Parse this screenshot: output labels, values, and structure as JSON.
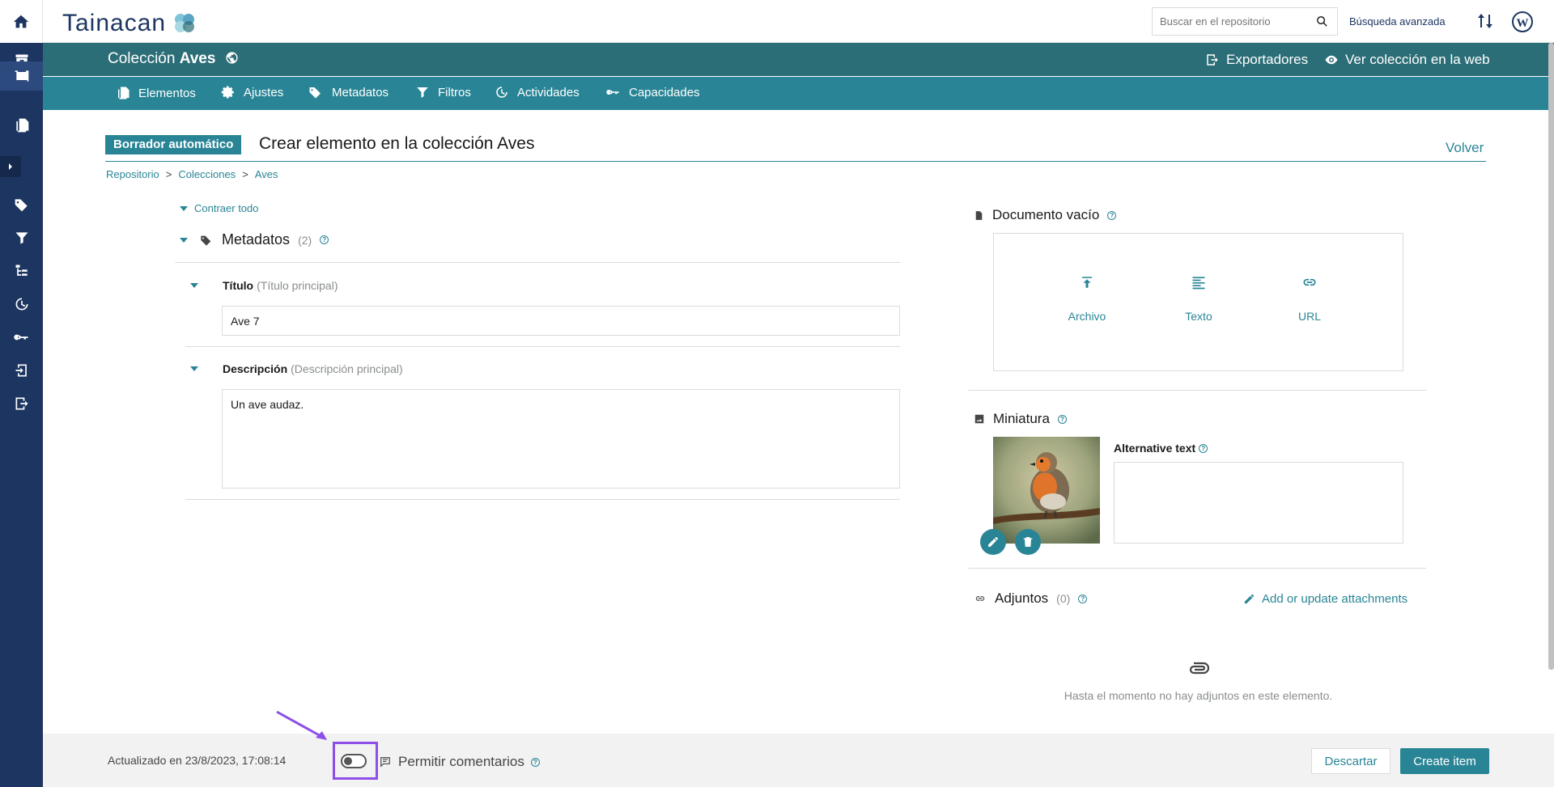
{
  "app": {
    "logo_text": "Tainacan",
    "accent": "#298596",
    "sidebar_bg": "#1d3661"
  },
  "topbar": {
    "search_placeholder": "Buscar en el repositorio",
    "advanced_search": "Búsqueda avanzada"
  },
  "collection": {
    "label": "Colección",
    "name": "Aves",
    "exporters": "Exportadores",
    "view_web": "Ver colección en la web"
  },
  "tabs": [
    {
      "label": "Elementos",
      "icon": "items-icon"
    },
    {
      "label": "Ajustes",
      "icon": "gear-icon"
    },
    {
      "label": "Metadatos",
      "icon": "tags-icon"
    },
    {
      "label": "Filtros",
      "icon": "filter-icon"
    },
    {
      "label": "Actividades",
      "icon": "activities-icon"
    },
    {
      "label": "Capacidades",
      "icon": "key-icon"
    }
  ],
  "page": {
    "badge": "Borrador automático",
    "title": "Crear elemento en la colección Aves",
    "back": "Volver",
    "breadcrumb": [
      "Repositorio",
      "Colecciones",
      "Aves"
    ],
    "breadcrumb_sep": ">"
  },
  "form": {
    "collapse_all": "Contraer todo",
    "metadata_section": "Metadatos",
    "metadata_count": "(2)",
    "fields": [
      {
        "label": "Título",
        "hint": "(Título principal)",
        "value": "Ave 7"
      },
      {
        "label": "Descripción",
        "hint": "(Descripción principal)",
        "value": "Un ave audaz."
      }
    ]
  },
  "document": {
    "title": "Documento vacío",
    "options": [
      "Archivo",
      "Texto",
      "URL"
    ]
  },
  "thumbnail": {
    "title": "Miniatura",
    "alt_label": "Alternative text",
    "alt_value": ""
  },
  "attachments": {
    "title": "Adjuntos",
    "count": "(0)",
    "action": "Add or update attachments",
    "empty": "Hasta el momento no hay adjuntos en este elemento."
  },
  "footer": {
    "updated": "Actualizado en 23/8/2023, 17:08:14",
    "comments_label": "Permitir comentarios",
    "comments_enabled": false,
    "discard": "Descartar",
    "create": "Create item"
  }
}
